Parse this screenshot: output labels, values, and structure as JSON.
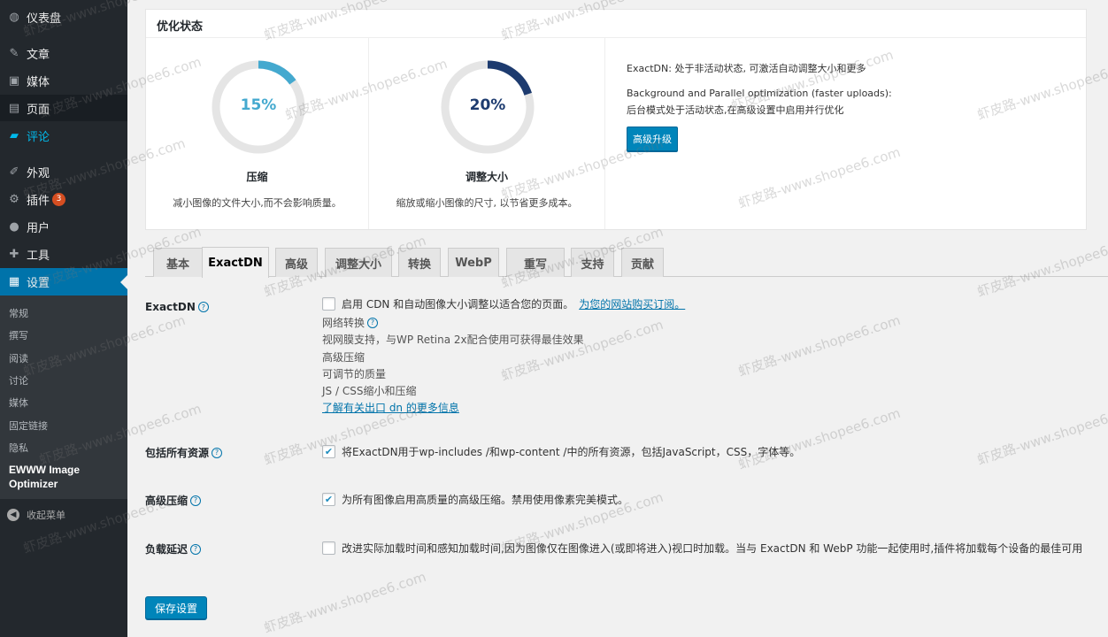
{
  "sidebar": {
    "items": [
      {
        "label": "仪表盘",
        "icon": "dashboard-icon",
        "glyph": "◍"
      },
      {
        "label": "文章",
        "icon": "pin-icon",
        "glyph": "✎"
      },
      {
        "label": "媒体",
        "icon": "media-icon",
        "glyph": "▣"
      },
      {
        "label": "页面",
        "icon": "page-icon",
        "glyph": "▤"
      },
      {
        "label": "评论",
        "icon": "comment-icon",
        "glyph": "▰"
      },
      {
        "label": "外观",
        "icon": "appearance-icon",
        "glyph": "✐"
      },
      {
        "label": "插件",
        "icon": "plugin-icon",
        "glyph": "⚙",
        "badge": "3"
      },
      {
        "label": "用户",
        "icon": "user-icon",
        "glyph": "●"
      },
      {
        "label": "工具",
        "icon": "wrench-icon",
        "glyph": "✚"
      },
      {
        "label": "设置",
        "icon": "settings-icon",
        "glyph": "▦"
      }
    ],
    "submenu": [
      "常规",
      "撰写",
      "阅读",
      "讨论",
      "媒体",
      "固定链接",
      "隐私"
    ],
    "submenu_current": "EWWW Image Optimizer",
    "collapse_label": "收起菜单"
  },
  "status": {
    "title": "优化状态",
    "compress": {
      "percent_text": "15%",
      "value": 0.15,
      "color": "#44a9cf",
      "label": "压缩",
      "desc": "减小图像的文件大小,而不会影响质量。"
    },
    "resize": {
      "percent_text": "20%",
      "value": 0.2,
      "color": "#1d3b6f",
      "label": "调整大小",
      "desc": "缩放或缩小图像的尺寸, 以节省更多成本。"
    },
    "exactdn_status": "ExactDN: 处于非活动状态, 可激活自动调整大小和更多",
    "bg_title": "Background and Parallel optimization (faster uploads):",
    "bg_status": "后台模式处于活动状态,在高级设置中启用并行优化",
    "upgrade_label": "高级升级"
  },
  "tabs": [
    "基本",
    "ExactDN",
    "高级",
    "调整大小",
    "转换",
    "WebP",
    "重写",
    "支持",
    "贡献"
  ],
  "active_tab": "ExactDN",
  "form": {
    "exactdn": {
      "label": "ExactDN",
      "option": "启用 CDN 和自动图像大小调整以适合您的页面。",
      "link": "为您的网站购买订阅。",
      "features": [
        "网络转换",
        "视网膜支持，与WP Retina 2x配合使用可获得最佳效果",
        "高级压缩",
        "可调节的质量",
        "JS / CSS缩小和压缩"
      ],
      "more_link": "了解有关出口 dn 的更多信息"
    },
    "all_assets": {
      "label": "包括所有资源",
      "option": "将ExactDN用于wp-includes /和wp-content /中的所有资源，包括JavaScript，CSS，字体等。"
    },
    "advanced": {
      "label": "高级压缩",
      "option": "为所有图像启用高质量的高级压缩。禁用使用像素完美模式。"
    },
    "lazy": {
      "label": "负载延迟",
      "option": "改进实际加载时间和感知加载时间,因为图像仅在图像进入(或即将进入)视口时加载。当与 ExactDN 和 WebP 功能一起使用时,插件将加载每个设备的最佳可用"
    }
  },
  "save_label": "保存设置",
  "watermark": "虾皮路-www.shopee6.com"
}
